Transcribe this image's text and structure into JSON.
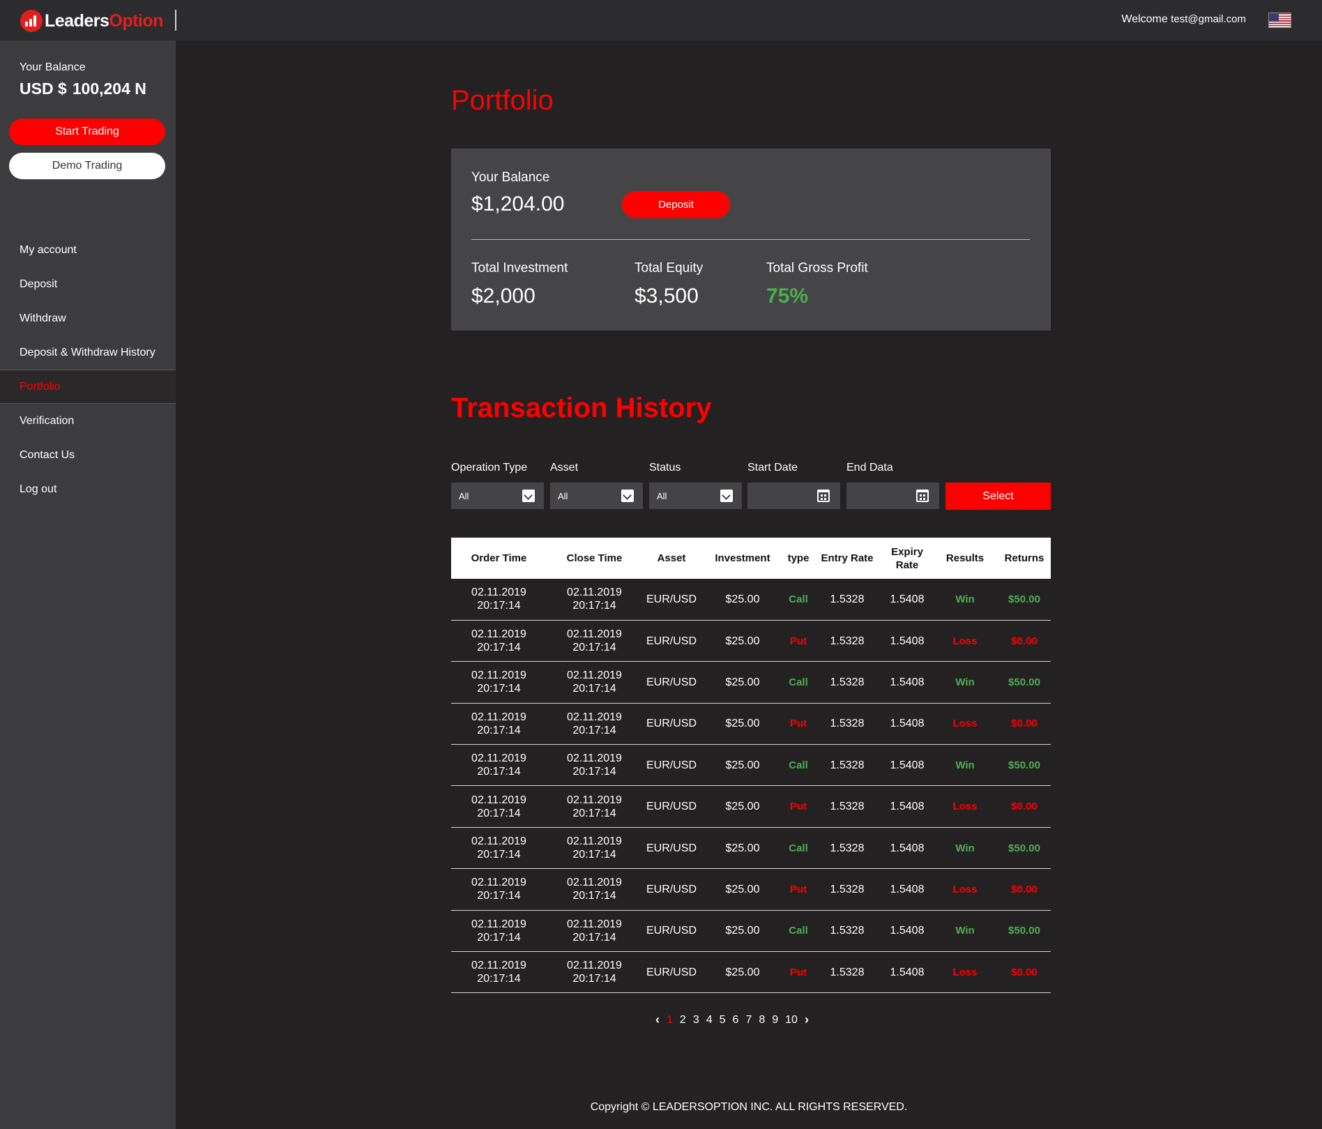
{
  "header": {
    "logo_part1": "Leaders",
    "logo_part2": "Option",
    "welcome_label": "Welcome",
    "user_email": "test@gmail.com"
  },
  "sidebar": {
    "balance_label": "Your Balance",
    "balance_currency": "USD $",
    "balance_value": "100,204 N",
    "start_trading": "Start Trading",
    "demo_trading": "Demo Trading",
    "items": [
      {
        "label": "My account",
        "active": false
      },
      {
        "label": "Deposit",
        "active": false
      },
      {
        "label": "Withdraw",
        "active": false
      },
      {
        "label": "Deposit & Withdraw History",
        "active": false
      },
      {
        "label": "Portfolio",
        "active": true
      },
      {
        "label": "Verification",
        "active": false
      },
      {
        "label": "Contact Us",
        "active": false
      },
      {
        "label": "Log out",
        "active": false
      }
    ]
  },
  "portfolio": {
    "title": "Portfolio",
    "balance_label": "Your Balance",
    "balance_value": "$1,204.00",
    "deposit_button": "Deposit",
    "total_investment_label": "Total Investment",
    "total_investment_value": "$2,000",
    "total_equity_label": "Total Equity",
    "total_equity_value": "$3,500",
    "total_gross_profit_label": "Total Gross Profit",
    "total_gross_profit_value": "75%"
  },
  "history": {
    "title": "Transaction History",
    "filters": {
      "operation_type_label": "Operation Type",
      "operation_type_value": "All",
      "asset_label": "Asset",
      "asset_value": "All",
      "status_label": "Status",
      "status_value": "All",
      "start_date_label": "Start Date",
      "end_date_label": "End Data",
      "select_button": "Select"
    },
    "columns": [
      "Order Time",
      "Close Time",
      "Asset",
      "Investment",
      "type",
      "Entry Rate",
      "Expiry Rate",
      "Results",
      "Returns"
    ],
    "rows": [
      {
        "order_time": "02.11.2019 20:17:14",
        "close_time": "02.11.2019 20:17:14",
        "asset": "EUR/USD",
        "investment": "$25.00",
        "type": "Call",
        "entry_rate": "1.5328",
        "expiry_rate": "1.5408",
        "result": "Win",
        "returns": "$50.00"
      },
      {
        "order_time": "02.11.2019 20:17:14",
        "close_time": "02.11.2019 20:17:14",
        "asset": "EUR/USD",
        "investment": "$25.00",
        "type": "Put",
        "entry_rate": "1.5328",
        "expiry_rate": "1.5408",
        "result": "Loss",
        "returns": "$0.00"
      },
      {
        "order_time": "02.11.2019 20:17:14",
        "close_time": "02.11.2019 20:17:14",
        "asset": "EUR/USD",
        "investment": "$25.00",
        "type": "Call",
        "entry_rate": "1.5328",
        "expiry_rate": "1.5408",
        "result": "Win",
        "returns": "$50.00"
      },
      {
        "order_time": "02.11.2019 20:17:14",
        "close_time": "02.11.2019 20:17:14",
        "asset": "EUR/USD",
        "investment": "$25.00",
        "type": "Put",
        "entry_rate": "1.5328",
        "expiry_rate": "1.5408",
        "result": "Loss",
        "returns": "$0.00"
      },
      {
        "order_time": "02.11.2019 20:17:14",
        "close_time": "02.11.2019 20:17:14",
        "asset": "EUR/USD",
        "investment": "$25.00",
        "type": "Call",
        "entry_rate": "1.5328",
        "expiry_rate": "1.5408",
        "result": "Win",
        "returns": "$50.00"
      },
      {
        "order_time": "02.11.2019 20:17:14",
        "close_time": "02.11.2019 20:17:14",
        "asset": "EUR/USD",
        "investment": "$25.00",
        "type": "Put",
        "entry_rate": "1.5328",
        "expiry_rate": "1.5408",
        "result": "Loss",
        "returns": "$0.00"
      },
      {
        "order_time": "02.11.2019 20:17:14",
        "close_time": "02.11.2019 20:17:14",
        "asset": "EUR/USD",
        "investment": "$25.00",
        "type": "Call",
        "entry_rate": "1.5328",
        "expiry_rate": "1.5408",
        "result": "Win",
        "returns": "$50.00"
      },
      {
        "order_time": "02.11.2019 20:17:14",
        "close_time": "02.11.2019 20:17:14",
        "asset": "EUR/USD",
        "investment": "$25.00",
        "type": "Put",
        "entry_rate": "1.5328",
        "expiry_rate": "1.5408",
        "result": "Loss",
        "returns": "$0.00"
      },
      {
        "order_time": "02.11.2019 20:17:14",
        "close_time": "02.11.2019 20:17:14",
        "asset": "EUR/USD",
        "investment": "$25.00",
        "type": "Call",
        "entry_rate": "1.5328",
        "expiry_rate": "1.5408",
        "result": "Win",
        "returns": "$50.00"
      },
      {
        "order_time": "02.11.2019 20:17:14",
        "close_time": "02.11.2019 20:17:14",
        "asset": "EUR/USD",
        "investment": "$25.00",
        "type": "Put",
        "entry_rate": "1.5328",
        "expiry_rate": "1.5408",
        "result": "Loss",
        "returns": "$0.00"
      }
    ],
    "pagination": {
      "prev": "‹",
      "next": "›",
      "pages": [
        "1",
        "2",
        "3",
        "4",
        "5",
        "6",
        "7",
        "8",
        "9",
        "10"
      ],
      "current": "1"
    }
  },
  "footer": {
    "copyright": "Copyright © LEADERSOPTION INC. ALL RIGHTS RESERVED."
  },
  "colors": {
    "accent": "#ff0000",
    "positive": "#4caf50",
    "background": "#232122",
    "sidebar": "#3c3c3e",
    "card": "#454547"
  },
  "icons": {
    "flag": "us-flag-icon",
    "calendar": "calendar-icon",
    "dropdown": "chevron-down-icon"
  }
}
